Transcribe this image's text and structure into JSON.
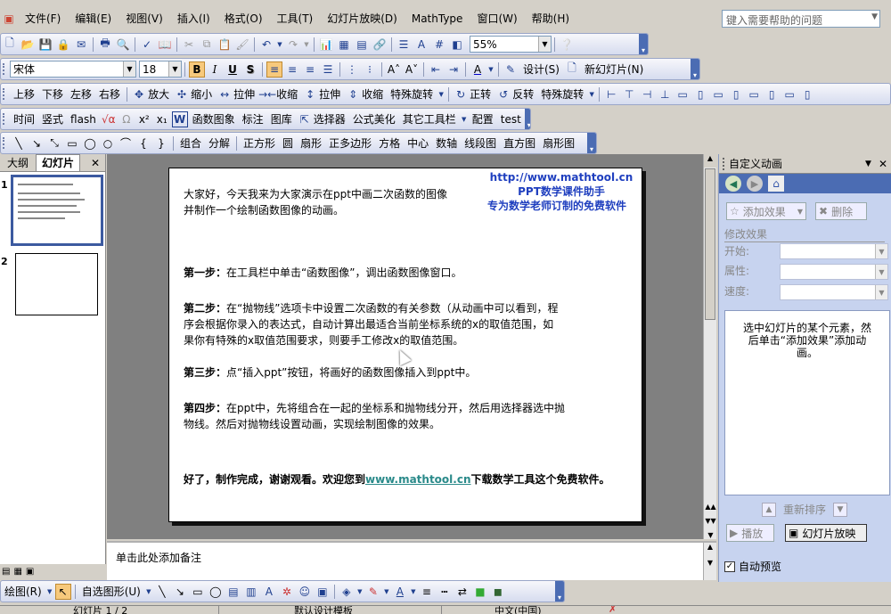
{
  "menubar": {
    "items": [
      "文件(F)",
      "编辑(E)",
      "视图(V)",
      "插入(I)",
      "格式(O)",
      "工具(T)",
      "幻灯片放映(D)",
      "MathType",
      "窗口(W)",
      "帮助(H)"
    ],
    "help_placeholder": "键入需要帮助的问题"
  },
  "standard_toolbar": {
    "zoom": "55%"
  },
  "format_toolbar": {
    "font": "宋体",
    "size": "18",
    "bold": "B",
    "italic": "I",
    "underline": "U",
    "shadow": "S",
    "design": "设计(S)",
    "new_slide": "新幻灯片(N)"
  },
  "toolbar3": {
    "items": [
      "上移",
      "下移",
      "左移",
      "右移",
      "放大",
      "缩小",
      "拉伸",
      "收缩",
      "拉伸",
      "收缩",
      "特殊旋转",
      "正转",
      "反转",
      "特殊旋转"
    ]
  },
  "toolbar4": {
    "items": [
      "时间",
      "竖式",
      "flash",
      "x²",
      "x₁",
      "函数图象",
      "标注",
      "图库",
      "选择器",
      "公式美化",
      "其它工具栏",
      "配置",
      "test"
    ]
  },
  "toolbar5": {
    "items": [
      "组合",
      "分解",
      "正方形",
      "圆",
      "扇形",
      "正多边形",
      "方格",
      "中心",
      "数轴",
      "线段图",
      "直方图",
      "扇形图"
    ]
  },
  "slide_panel": {
    "tab_outline": "大纲",
    "tab_slides": "幻灯片",
    "slide_numbers": [
      "1",
      "2"
    ]
  },
  "slide": {
    "header_lines": [
      "http://www.mathtool.cn",
      "PPT数学课件助手",
      "专为数学老师订制的免费软件"
    ],
    "intro_lines": [
      "大家好，今天我来为大家演示在ppt中画二次函数的图像",
      "并制作一个绘制函数图像的动画。"
    ],
    "steps": [
      {
        "label": "第一步：",
        "lines": [
          "在工具栏中单击“函数图像”，调出函数图像窗口。"
        ]
      },
      {
        "label": "第二步：",
        "lines": [
          "在“抛物线”选项卡中设置二次函数的有关参数（从动画中可以看到，程",
          "序会根据你录入的表达式，自动计算出最适合当前坐标系统的x的取值范围，如",
          "果你有特殊的x取值范围要求，则要手工修改x的取值范围。"
        ]
      },
      {
        "label": "第三步：",
        "lines": [
          "点“插入ppt”按钮，将画好的函数图像插入到ppt中。"
        ]
      },
      {
        "label": "第四步：",
        "lines": [
          "在ppt中，先将组合在一起的坐标系和抛物线分开，然后用选择器选中抛",
          "物线。然后对抛物线设置动画，实现绘制图像的效果。"
        ]
      }
    ],
    "closing_pre": "好了，制作完成，谢谢观看。欢迎您到",
    "closing_link": "www.mathtool.cn",
    "closing_post": "下载数学工具这个免费软件。"
  },
  "notes": {
    "placeholder": "单击此处添加备注"
  },
  "task_pane": {
    "title": "自定义动画",
    "add_effect": "添加效果",
    "delete": "删除",
    "modify_effect": "修改效果",
    "start_label": "开始:",
    "property_label": "属性:",
    "speed_label": "速度:",
    "hint_lines": [
      "选中幻灯片的某个元素，然",
      "后单击“添加效果”添加动",
      "画。"
    ],
    "reorder": "重新排序",
    "play": "播放",
    "slideshow": "幻灯片放映",
    "autopreview": "自动预览"
  },
  "drawing_toolbar": {
    "draw": "绘图(R)",
    "autoshapes": "自选图形(U)"
  },
  "statusbar": {
    "slide": "幻灯片 1 / 2",
    "template": "默认设计模板",
    "language": "中文(中国)"
  }
}
